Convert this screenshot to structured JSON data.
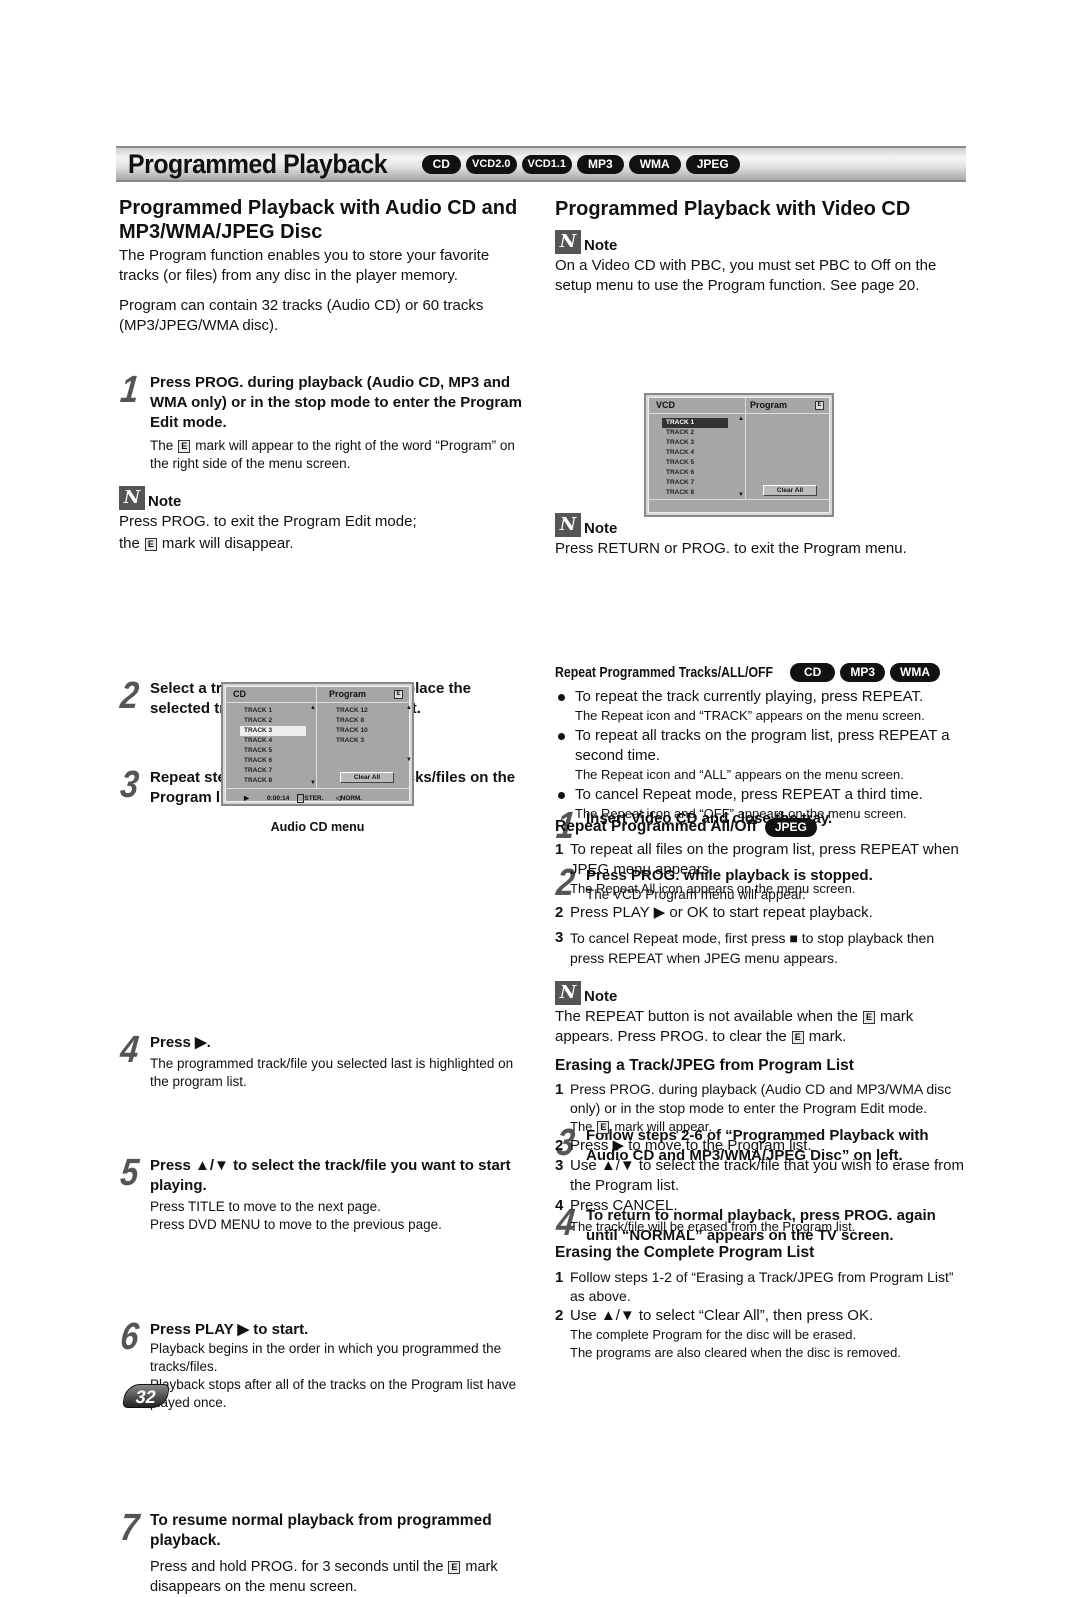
{
  "header": {
    "title": "Programmed Playback",
    "badges": [
      "CD",
      "VCD2.0",
      "VCD1.1",
      "MP3",
      "WMA",
      "JPEG"
    ]
  },
  "left": {
    "heading": "Programmed Playback with Audio CD and MP3/WMA/JPEG Disc",
    "intro1": "The Program function enables you to store your favorite tracks (or files) from any disc in the player memory.",
    "intro2": "Program can contain 32 tracks (Audio CD) or 60 tracks (MP3/JPEG/WMA disc).",
    "step1": {
      "num": "1",
      "head": "Press PROG. during playback (Audio CD, MP3 and WMA only) or in the stop mode to enter the Program Edit mode.",
      "desc_a": "The",
      "desc_b": "mark will appear to the right of the word “Program” on the right side of the menu screen."
    },
    "note1": {
      "label": "Note",
      "text_a": "Press PROG. to exit the Program Edit mode;",
      "text_b": "the",
      "text_c": "mark will disappear."
    },
    "step2": {
      "num": "2",
      "head": "Select a track/file, then press OK to place the selected track/file on the Program list."
    },
    "step3": {
      "num": "3",
      "head": "Repeat step 2 to place additional tracks/files on the Program list."
    },
    "audio_menu": {
      "left_header": "CD",
      "right_header": "Program",
      "edit_mark": "E",
      "tracks": [
        "TRACK 1",
        "TRACK 2",
        "TRACK 3",
        "TRACK 4",
        "TRACK 5",
        "TRACK 6",
        "TRACK 7",
        "TRACK 8"
      ],
      "selected_track": "TRACK 3",
      "program": [
        "TRACK 12",
        "TRACK 8",
        "TRACK 10",
        "TRACK 3"
      ],
      "clear_all": "Clear All",
      "status": {
        "play": "▶",
        "time": "0:00:14",
        "audio": "STER.",
        "sound": "NORM."
      },
      "caption": "Audio CD menu"
    },
    "step4": {
      "num": "4",
      "head": "Press ▶.",
      "desc": "The programmed track/file you selected last is highlighted on the program list."
    },
    "step5": {
      "num": "5",
      "head": "Press ▲/▼ to select the track/file you want to start playing.",
      "desc1": "Press TITLE to move to the next page.",
      "desc2": "Press DVD MENU to move to the previous page."
    },
    "step6": {
      "num": "6",
      "head": "Press PLAY ▶ to start.",
      "desc1": "Playback begins in the order in which you programmed the tracks/files.",
      "desc2": "Playback stops after all of the tracks on the Program list have played once."
    },
    "step7": {
      "num": "7",
      "head": "To resume normal playback from programmed playback.",
      "desc_a": "Press and hold PROG. for 3 seconds until the",
      "desc_b": "mark disappears on the menu screen."
    }
  },
  "right": {
    "heading": "Programmed Playback with Video CD",
    "note1": {
      "label": "Note",
      "text": "On a Video CD with PBC, you must set PBC to Off on the setup menu to use the Program function. See page 20."
    },
    "step1": {
      "num": "1",
      "head": "Insert Video CD and close the tray."
    },
    "step2": {
      "num": "2",
      "head": "Press PROG. while playback is stopped.",
      "desc": "The VCD Program menu will appear."
    },
    "vcd_menu": {
      "left_header": "VCD",
      "right_header": "Program",
      "edit_mark": "E",
      "tracks": [
        "TRACK 1",
        "TRACK 2",
        "TRACK 3",
        "TRACK 4",
        "TRACK 5",
        "TRACK 6",
        "TRACK 7",
        "TRACK 8"
      ],
      "selected_track": "TRACK 1",
      "clear_all": "Clear All"
    },
    "note2": {
      "label": "Note",
      "text": "Press RETURN or PROG. to exit the Program menu."
    },
    "step3": {
      "num": "3",
      "head": "Follow steps 2-6 of “Programmed Playback with Audio CD and MP3/WMA/JPEG Disc” on left."
    },
    "step4": {
      "num": "4",
      "head": "To return to normal playback, press PROG. again until “NORMAL” appears on the TV screen."
    },
    "repeat_tracks": {
      "heading": "Repeat Programmed Tracks/ALL/OFF",
      "badges": [
        "CD",
        "MP3",
        "WMA"
      ],
      "bullets": [
        {
          "text": "To repeat the track currently playing, press REPEAT.",
          "sub": "The Repeat icon and “TRACK” appears on the menu screen."
        },
        {
          "text": "To repeat all tracks on the program list, press REPEAT a second time.",
          "sub": "The Repeat icon and “ALL” appears on the menu screen."
        },
        {
          "text": "To cancel Repeat mode, press REPEAT a third time.",
          "sub": "The Repeat icon and “OFF” appears on the menu screen."
        }
      ]
    },
    "repeat_all": {
      "heading": "Repeat Programmed All/Off",
      "badge": "JPEG",
      "items": [
        {
          "n": "1",
          "text": "To repeat all files on the program list, press REPEAT when JPEG menu appears.",
          "sub": "The Repeat All icon appears on the menu screen."
        },
        {
          "n": "2",
          "text": "Press PLAY ▶ or OK to start repeat playback."
        },
        {
          "n": "3",
          "text_a": "To cancel Repeat mode, first press",
          "text_b": "to stop playback then press REPEAT when JPEG menu appears."
        }
      ]
    },
    "note3": {
      "label": "Note",
      "text_a": "The REPEAT button is not available when the",
      "text_b": "mark appears. Press PROG. to clear the",
      "text_c": "mark."
    },
    "erase_track": {
      "heading": "Erasing a Track/JPEG from Program List",
      "items": [
        {
          "n": "1",
          "text": "Press PROG. during playback (Audio CD and MP3/WMA disc only) or in the stop mode to enter the Program Edit mode.",
          "sub_a": "The",
          "sub_b": "mark will appear."
        },
        {
          "n": "2",
          "text": "Press ▶ to move to the Program list."
        },
        {
          "n": "3",
          "text": "Use ▲/▼ to select the track/file that you wish to erase from the Program list."
        },
        {
          "n": "4",
          "text": "Press CANCEL.",
          "sub": "The track/file will be erased from the Program list."
        }
      ]
    },
    "erase_all": {
      "heading": "Erasing the Complete Program List",
      "items": [
        {
          "n": "1",
          "text": "Follow steps 1-2 of “Erasing a Track/JPEG from Program List” as above."
        },
        {
          "n": "2",
          "text": "Use ▲/▼ to select “Clear All”, then press OK.",
          "sub1": "The complete Program for the disc will be erased.",
          "sub2": "The programs are also cleared when the disc is removed."
        }
      ]
    }
  },
  "footer": {
    "page_number": "32"
  }
}
